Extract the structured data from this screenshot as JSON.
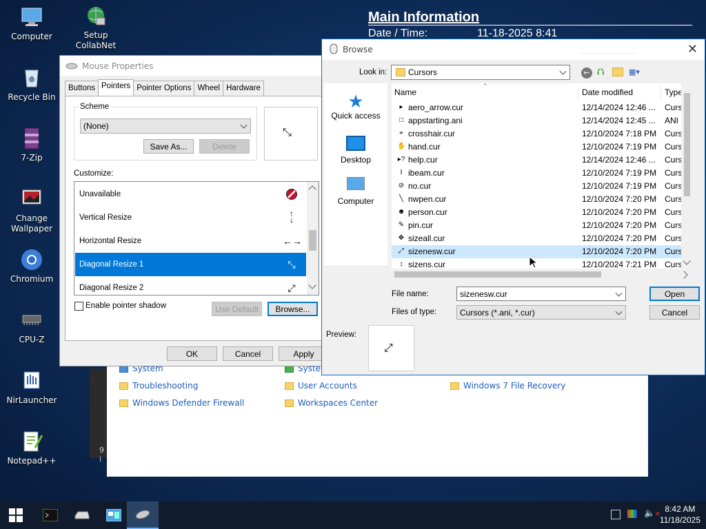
{
  "desktop": {
    "icons": [
      {
        "label": "Computer",
        "icon": "computer-icon"
      },
      {
        "label": "Setup CollabNet",
        "icon": "globe-setup-icon"
      },
      {
        "label": "Recycle Bin",
        "icon": "recycle-bin-icon"
      },
      {
        "label": "7-Zip",
        "icon": "archive-icon"
      },
      {
        "label": "Change Wallpaper",
        "icon": "wallpaper-icon"
      },
      {
        "label": "Chromium",
        "icon": "chromium-icon"
      },
      {
        "label": "CPU-Z",
        "icon": "chip-icon"
      },
      {
        "label": "NirLauncher",
        "icon": "launcher-icon"
      },
      {
        "label": "Notepad++",
        "icon": "notepad-icon"
      }
    ],
    "bginfo": {
      "title": "Main Information",
      "date_label": "Date / Time:",
      "date_value": "11-18-2025 8:41"
    }
  },
  "control_panel": {
    "items": [
      "System",
      "System",
      "Troubleshooting",
      "User Accounts",
      "Windows 7 File Recovery",
      "Windows Defender Firewall",
      "Workspaces Center"
    ],
    "status": "9 i"
  },
  "mouse_props": {
    "title": "Mouse Properties",
    "tabs": [
      "Buttons",
      "Pointers",
      "Pointer Options",
      "Wheel",
      "Hardware"
    ],
    "scheme_group": "Scheme",
    "scheme_value": "(None)",
    "save_as": "Save As...",
    "delete": "Delete",
    "customize_label": "Customize:",
    "cursors": [
      {
        "name": "Unavailable",
        "icon": "no-icon"
      },
      {
        "name": "Vertical Resize",
        "icon": "vertical-resize-icon"
      },
      {
        "name": "Horizontal Resize",
        "icon": "horizontal-resize-icon"
      },
      {
        "name": "Diagonal Resize 1",
        "icon": "diagonal-resize-1-icon"
      },
      {
        "name": "Diagonal Resize 2",
        "icon": "diagonal-resize-2-icon"
      }
    ],
    "shadow_label": "Enable pointer shadow",
    "use_default": "Use Default",
    "browse": "Browse...",
    "ok": "OK",
    "cancel": "Cancel",
    "apply": "Apply"
  },
  "browse": {
    "title": "Browse",
    "look_in_label": "Look in:",
    "look_in_value": "Cursors",
    "places": [
      "Quick access",
      "Desktop",
      "Computer"
    ],
    "columns": [
      "Name",
      "Date modified",
      "Type"
    ],
    "files": [
      {
        "name": "aero_arrow.cur",
        "date": "12/14/2024 12:46 ...",
        "type": "Cursor"
      },
      {
        "name": "appstarting.ani",
        "date": "12/14/2024 12:45 ...",
        "type": "ANI Fil"
      },
      {
        "name": "crosshair.cur",
        "date": "12/10/2024 7:18 PM",
        "type": "Cursor"
      },
      {
        "name": "hand.cur",
        "date": "12/10/2024 7:19 PM",
        "type": "Cursor"
      },
      {
        "name": "help.cur",
        "date": "12/14/2024 12:46 ...",
        "type": "Cursor"
      },
      {
        "name": "ibeam.cur",
        "date": "12/10/2024 7:19 PM",
        "type": "Cursor"
      },
      {
        "name": "no.cur",
        "date": "12/10/2024 7:19 PM",
        "type": "Cursor"
      },
      {
        "name": "nwpen.cur",
        "date": "12/10/2024 7:20 PM",
        "type": "Cursor"
      },
      {
        "name": "person.cur",
        "date": "12/10/2024 7:20 PM",
        "type": "Cursor"
      },
      {
        "name": "pin.cur",
        "date": "12/10/2024 7:20 PM",
        "type": "Cursor"
      },
      {
        "name": "sizeall.cur",
        "date": "12/10/2024 7:20 PM",
        "type": "Cursor"
      },
      {
        "name": "sizenesw.cur",
        "date": "12/10/2024 7:20 PM",
        "type": "Cursor"
      },
      {
        "name": "sizens.cur",
        "date": "12/10/2024 7:21 PM",
        "type": "Cursor"
      }
    ],
    "file_name_label": "File name:",
    "file_name_value": "sizenesw.cur",
    "file_type_label": "Files of type:",
    "file_type_value": "Cursors (*.ani, *.cur)",
    "open": "Open",
    "cancel": "Cancel",
    "preview_label": "Preview:"
  },
  "taskbar": {
    "time": "8:42 AM",
    "date": "11/18/2025"
  }
}
